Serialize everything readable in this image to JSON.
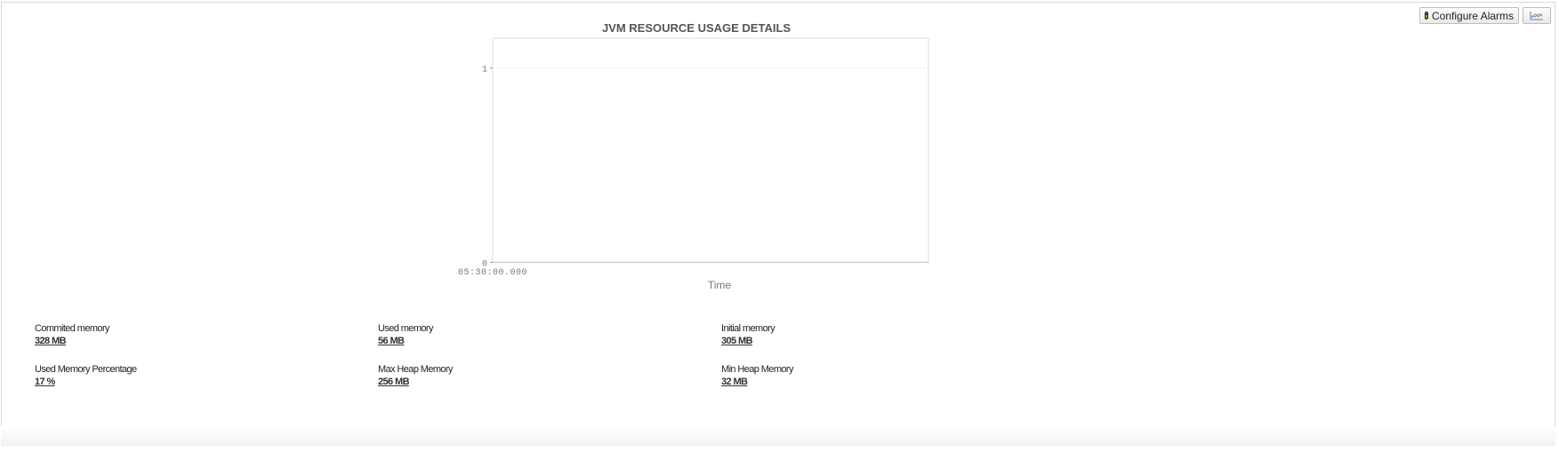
{
  "toolbar": {
    "configure_alarms_label": "Configure Alarms",
    "configure_alarms_icon": "traffic-light-icon",
    "chart_toggle_icon": "chart-icon"
  },
  "chart_data": {
    "type": "line",
    "title": "JVM RESOURCE USAGE DETAILS",
    "xlabel": "Time",
    "ylabel": "",
    "x_ticks": [
      "05:30:00.000"
    ],
    "y_ticks": [
      0,
      1
    ],
    "ylim": [
      0,
      1.15
    ],
    "series": [],
    "grid": true
  },
  "metrics": [
    {
      "label": "Commited memory",
      "value": "328 MB"
    },
    {
      "label": "Used memory",
      "value": "56 MB"
    },
    {
      "label": "Initial memory",
      "value": "305 MB"
    },
    {
      "label": "Used Memory Percentage",
      "value": "17 %"
    },
    {
      "label": "Max Heap Memory",
      "value": "256 MB"
    },
    {
      "label": "Min Heap Memory",
      "value": "32 MB"
    }
  ]
}
